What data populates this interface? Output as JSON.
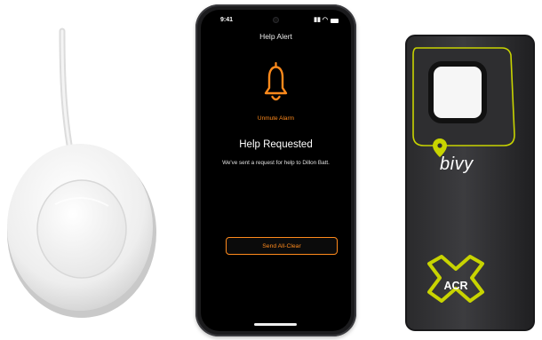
{
  "phone": {
    "status_time": "9:41",
    "nav_title": "Help Alert",
    "bell_icon": "bell-icon",
    "unmute_label": "Unmute Alarm",
    "status_heading": "Help Requested",
    "status_message": "We've sent a request for help to Dillon Batt.",
    "all_clear_label": "Send All-Clear",
    "accent_color": "#ff8a1c"
  },
  "tracker": {
    "brand_label": "bivy",
    "maker_label": "ACR",
    "accent_color": "#c8d400"
  }
}
